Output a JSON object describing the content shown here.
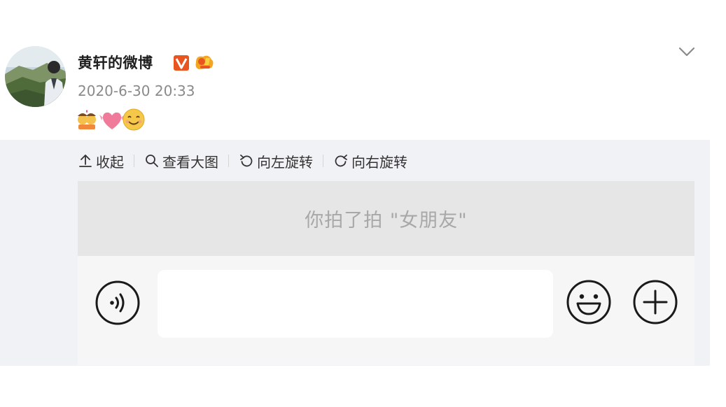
{
  "post": {
    "username": "黄轩的微博",
    "timestamp": "2020-6-30 20:33",
    "avatar_icon": "avatar-photo-icon",
    "badges": [
      "v-verified-icon",
      "fan-badge-icon"
    ],
    "emojis": [
      "couple-kiss-emoji",
      "heart-ribbon-emoji",
      "smiling-face-emoji"
    ]
  },
  "toolbar": {
    "collapse_label": "收起",
    "view_large_label": "查看大图",
    "rotate_left_label": "向左旋转",
    "rotate_right_label": "向右旋转"
  },
  "chat": {
    "pat_text": "你拍了拍 \"女朋友\"",
    "input_value": "",
    "icons": [
      "voice-icon",
      "emoji-icon",
      "plus-icon"
    ]
  },
  "colors": {
    "panel_bg": "#f1f2f5",
    "chat_top_bg": "#e6e6e6",
    "badge_orange": "#e8551f"
  }
}
